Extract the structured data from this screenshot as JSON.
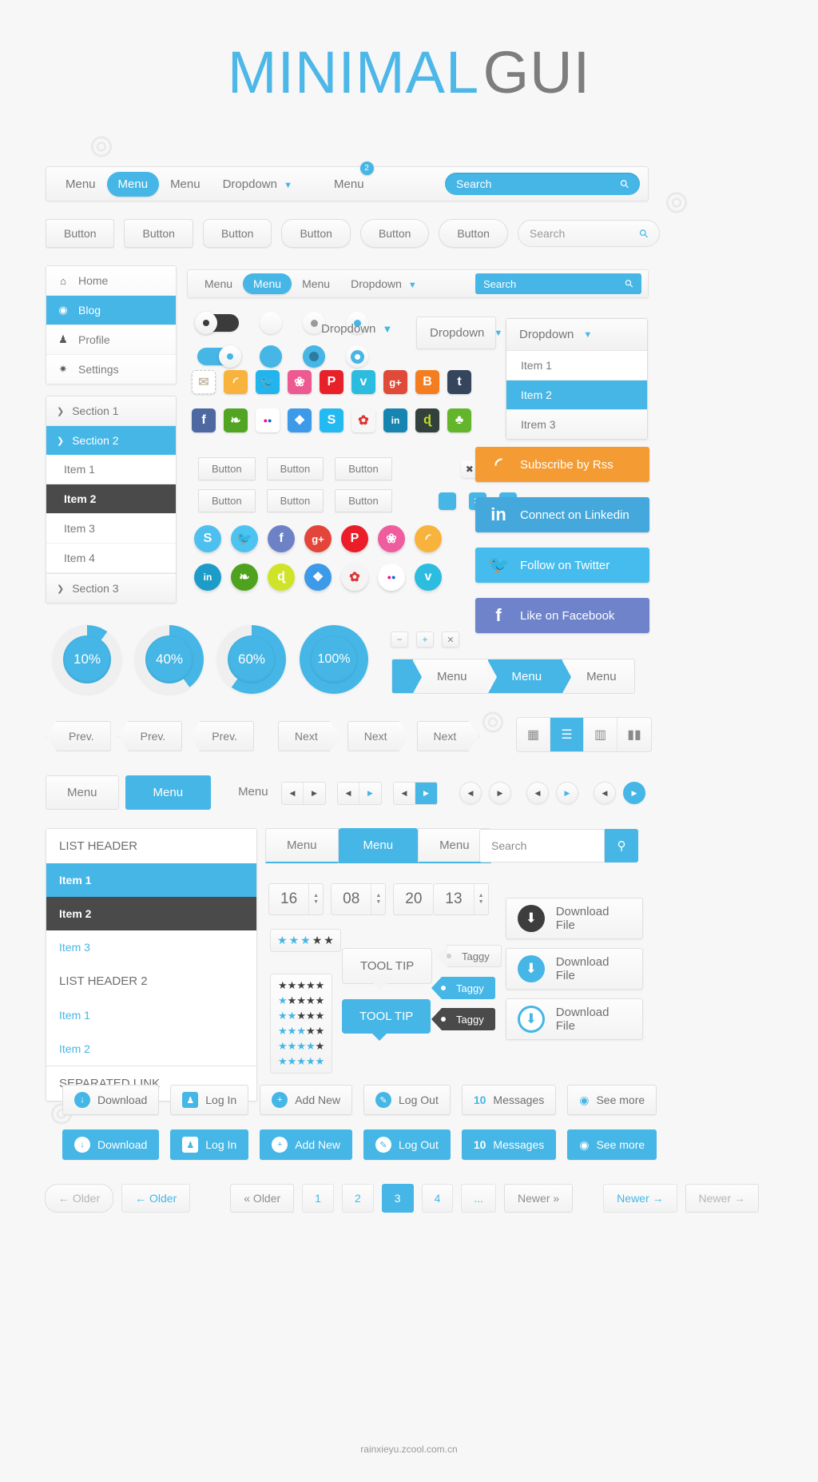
{
  "title": {
    "part1": "MINIMAL",
    "part2": "GUI"
  },
  "navbar1": {
    "items": [
      {
        "label": "Menu",
        "state": "normal"
      },
      {
        "label": "Menu",
        "state": "active"
      },
      {
        "label": "Menu",
        "state": "normal"
      },
      {
        "label": "Dropdown",
        "state": "dropdown"
      },
      {
        "label": "Menu",
        "state": "badge",
        "badge": "2"
      }
    ],
    "search_placeholder": "Search",
    "search_icon": "search-icon"
  },
  "buttonrow": {
    "buttons": [
      "Button",
      "Button",
      "Button",
      "Button",
      "Button",
      "Button"
    ],
    "search_placeholder": "Search"
  },
  "sidebar": {
    "items": [
      {
        "label": "Home",
        "icon": "home-icon",
        "active": false
      },
      {
        "label": "Blog",
        "icon": "record-icon",
        "active": true
      },
      {
        "label": "Profile",
        "icon": "user-icon",
        "active": false
      },
      {
        "label": "Settings",
        "icon": "gear-icon",
        "active": false
      }
    ]
  },
  "accordion": {
    "sections": [
      {
        "label": "Section 1",
        "open": false
      },
      {
        "label": "Section 2",
        "open": true
      },
      {
        "label": "Section 3",
        "open": false
      }
    ],
    "items": [
      {
        "label": "Item 1",
        "state": "normal"
      },
      {
        "label": "Item 2",
        "state": "dark"
      },
      {
        "label": "Item 3",
        "state": "normal"
      },
      {
        "label": "Item 4",
        "state": "normal"
      }
    ]
  },
  "navbar2": {
    "items": [
      {
        "label": "Menu",
        "state": "normal"
      },
      {
        "label": "Menu",
        "state": "active"
      },
      {
        "label": "Menu",
        "state": "normal"
      },
      {
        "label": "Dropdown",
        "state": "dropdown"
      }
    ],
    "search_placeholder": "Search"
  },
  "dropdowns": {
    "plain": "Dropdown",
    "boxed": "Dropdown",
    "open_header": "Dropdown",
    "open_items": [
      "Item 1",
      "Item 2",
      "Itrem 3"
    ],
    "selected_index": 1
  },
  "social_squares_row1": [
    {
      "name": "mail-icon",
      "glyph": "✉",
      "bg": "#ffffff",
      "fg": "#c9bba8"
    },
    {
      "name": "rss-icon",
      "glyph": "◜",
      "bg": "#f8b33c",
      "fg": "#ffffff"
    },
    {
      "name": "twitter-icon",
      "glyph": "t",
      "bg": "#22b4ed",
      "fg": "#ffffff"
    },
    {
      "name": "dribbble-icon",
      "glyph": "❀",
      "bg": "#ed5a92",
      "fg": "#ffffff"
    },
    {
      "name": "pinterest-icon",
      "glyph": "P",
      "bg": "#e8202a",
      "fg": "#ffffff"
    },
    {
      "name": "vimeo-icon",
      "glyph": "v",
      "bg": "#2bbce0",
      "fg": "#ffffff"
    },
    {
      "name": "googleplus-icon",
      "glyph": "g+",
      "bg": "#e04a39",
      "fg": "#ffffff"
    },
    {
      "name": "blogger-icon",
      "glyph": "B",
      "bg": "#f57d21",
      "fg": "#ffffff"
    },
    {
      "name": "tumblr-icon",
      "glyph": "t",
      "bg": "#35465c",
      "fg": "#ffffff"
    }
  ],
  "social_squares_row2": [
    {
      "name": "facebook-icon",
      "glyph": "f",
      "bg": "#4e69a2",
      "fg": "#ffffff"
    },
    {
      "name": "evernote-icon",
      "glyph": "❧",
      "bg": "#52a522",
      "fg": "#ffffff"
    },
    {
      "name": "flickr-icon",
      "glyph": "●●",
      "bg": "#ffffff",
      "fg": "#ff0084"
    },
    {
      "name": "dropbox-icon",
      "glyph": "❖",
      "bg": "#3d9ae8",
      "fg": "#ffffff"
    },
    {
      "name": "skype-icon",
      "glyph": "S",
      "bg": "#23baf2",
      "fg": "#ffffff"
    },
    {
      "name": "picasa-icon",
      "glyph": "✿",
      "bg": "#f6f6f6",
      "fg": "#6c3",
      "fg2": "#d33"
    },
    {
      "name": "linkedin-icon",
      "glyph": "in",
      "bg": "#1686b0",
      "fg": "#ffffff"
    },
    {
      "name": "deviantart-icon",
      "glyph": "ɖ",
      "bg": "#33413d",
      "fg": "#c5e021"
    },
    {
      "name": "forrst-icon",
      "glyph": "♣",
      "bg": "#63b62b",
      "fg": "#ffffff"
    }
  ],
  "social_round_row1": [
    {
      "name": "skype-icon",
      "glyph": "S",
      "bg": "#4ec0f0"
    },
    {
      "name": "twitter-icon",
      "glyph": "t",
      "bg": "#4cc3f0"
    },
    {
      "name": "facebook-icon",
      "glyph": "f",
      "bg": "#6d82c6"
    },
    {
      "name": "googleplus-icon",
      "glyph": "g+",
      "bg": "#e4453a"
    },
    {
      "name": "pinterest-icon",
      "glyph": "P",
      "bg": "#ea1d28"
    },
    {
      "name": "dribbble-icon",
      "glyph": "❀",
      "bg": "#ef5d9e"
    },
    {
      "name": "rss-icon",
      "glyph": "◜",
      "bg": "#f8b33c"
    }
  ],
  "social_round_row2": [
    {
      "name": "linkedin-icon",
      "glyph": "in",
      "bg": "#1e9cc9"
    },
    {
      "name": "evernote-icon",
      "glyph": "❧",
      "bg": "#4fa21e"
    },
    {
      "name": "deviantart-icon",
      "glyph": "ɖ",
      "bg": "#cfe428"
    },
    {
      "name": "dropbox-icon",
      "glyph": "❖",
      "bg": "#3d9ae8"
    },
    {
      "name": "picasa-icon",
      "glyph": "✿",
      "bg": "#f4f4f4"
    },
    {
      "name": "flickr-icon",
      "glyph": "●●",
      "bg": "#ffffff"
    },
    {
      "name": "vimeo-icon",
      "glyph": "v",
      "bg": "#2bbce0"
    }
  ],
  "big_social": [
    {
      "label": "Subscribe by Rss",
      "icon": "rss-icon",
      "glyph": "◜",
      "bg": "#f59b33"
    },
    {
      "label": "Connect on Linkedin",
      "icon": "linkedin-icon",
      "glyph": "in",
      "bg": "#45a8dd"
    },
    {
      "label": "Follow on Twitter",
      "icon": "twitter-icon",
      "glyph": "t",
      "bg": "#45bced"
    },
    {
      "label": "Like on Facebook",
      "icon": "facebook-icon",
      "glyph": "f",
      "bg": "#6e83c9"
    }
  ],
  "small_buttons": {
    "row1": [
      "Button",
      "Button",
      "Button"
    ],
    "row2": [
      "Button",
      "Button",
      "Button"
    ]
  },
  "checkboxes": {
    "row1": [
      {
        "name": "close-icon",
        "glyph": "✖",
        "style": "light-dark"
      },
      {
        "name": "check-icon",
        "glyph": "✔",
        "style": "light-blue"
      }
    ],
    "row2": [
      {
        "name": "square-icon",
        "glyph": "",
        "style": "solid"
      },
      {
        "name": "close-icon",
        "glyph": "✖",
        "style": "solid"
      },
      {
        "name": "check-icon",
        "glyph": "✔",
        "style": "solid"
      }
    ]
  },
  "donuts": [
    {
      "label": "10%",
      "value": 10
    },
    {
      "label": "40%",
      "value": 40
    },
    {
      "label": "60%",
      "value": 60
    },
    {
      "label": "100%",
      "value": 100
    }
  ],
  "zoom_controls": [
    {
      "name": "minus-icon",
      "glyph": "−"
    },
    {
      "name": "plus-icon",
      "glyph": "+"
    },
    {
      "name": "close-icon",
      "glyph": "✕"
    }
  ],
  "breadcrumbs": [
    {
      "label": "",
      "state": "blue"
    },
    {
      "label": "Menu",
      "state": "light"
    },
    {
      "label": "Menu",
      "state": "blue"
    },
    {
      "label": "Menu",
      "state": "light"
    }
  ],
  "prevnext": {
    "prev": [
      "Prev.",
      "Prev.",
      "Prev."
    ],
    "next": [
      "Next",
      "Next",
      "Next"
    ]
  },
  "viewswitch": [
    {
      "name": "grid-view-icon",
      "glyph": "▦",
      "on": false
    },
    {
      "name": "list-view-icon",
      "glyph": "☰",
      "on": true
    },
    {
      "name": "column-view-icon",
      "glyph": "⫼",
      "on": false
    },
    {
      "name": "gallery-view-icon",
      "glyph": "‖▮",
      "on": false
    }
  ],
  "tabs_row": [
    {
      "label": "Menu",
      "on": false
    },
    {
      "label": "Menu",
      "on": true
    },
    {
      "label": "Menu",
      "on": false
    }
  ],
  "pagers": {
    "squares": [
      {
        "left": "◀",
        "right": "▶",
        "style": "plain"
      },
      {
        "left": "◀",
        "right": "▶",
        "style": "blue-arrow"
      },
      {
        "left": "◀",
        "right": "▶",
        "style": "blue-bg"
      }
    ],
    "circles": [
      {
        "left": "◀",
        "right": "▶",
        "style": "plain"
      },
      {
        "left": "◀",
        "right": "▶",
        "style": "blue-arrow"
      },
      {
        "left": "◀",
        "right": "▶",
        "style": "blue-bg"
      }
    ]
  },
  "list_panel": [
    {
      "label": "LIST HEADER",
      "type": "header"
    },
    {
      "label": "Item 1",
      "type": "blue"
    },
    {
      "label": "Item 2",
      "type": "dark"
    },
    {
      "label": "Item 3",
      "type": "link"
    },
    {
      "label": "LIST HEADER 2",
      "type": "header"
    },
    {
      "label": "Item 1",
      "type": "link"
    },
    {
      "label": "Item 2",
      "type": "link"
    },
    {
      "label": "SEPARATED LINK",
      "type": "sep"
    }
  ],
  "tabs_panel": [
    {
      "label": "Menu",
      "on": false
    },
    {
      "label": "Menu",
      "on": true
    },
    {
      "label": "Menu",
      "on": false
    }
  ],
  "search_panel": {
    "placeholder": "Search",
    "icon": "search-icon"
  },
  "spinners": [
    {
      "value": "16"
    },
    {
      "value": "08"
    },
    {
      "value": "20"
    },
    {
      "value": "13"
    }
  ],
  "stars": [
    {
      "filled": 3,
      "total": 5
    },
    {
      "filled": 0,
      "total": 5
    },
    {
      "filled": 1,
      "total": 5
    },
    {
      "filled": 2,
      "total": 5
    },
    {
      "filled": 3,
      "total": 5
    },
    {
      "filled": 4,
      "total": 5
    },
    {
      "filled": 5,
      "total": 5
    }
  ],
  "tooltips": [
    {
      "label": "TOOL TIP",
      "style": "light"
    },
    {
      "label": "TOOL TIP",
      "style": "blue"
    }
  ],
  "taggy": [
    {
      "label": "Taggy",
      "style": "light"
    },
    {
      "label": "Taggy",
      "style": "blue"
    },
    {
      "label": "Taggy",
      "style": "dark"
    }
  ],
  "downloads": [
    {
      "label": "Download File",
      "style": "dark",
      "icon": "download-icon"
    },
    {
      "label": "Download File",
      "style": "blue",
      "icon": "download-icon"
    },
    {
      "label": "Download File",
      "style": "outline",
      "icon": "download-icon"
    }
  ],
  "actions_row1": [
    {
      "label": "Download",
      "icon": "download-icon",
      "glyph": "↓"
    },
    {
      "label": "Log In",
      "icon": "user-icon",
      "glyph": "♟"
    },
    {
      "label": "Add New",
      "icon": "plus-icon",
      "glyph": "+"
    },
    {
      "label": "Log Out",
      "icon": "pencil-icon",
      "glyph": "✎"
    },
    {
      "label": "Messages",
      "icon": "message-icon",
      "count": "10"
    },
    {
      "label": "See more",
      "icon": "eye-icon",
      "glyph": "◉"
    }
  ],
  "actions_row2": [
    {
      "label": "Download",
      "icon": "download-icon",
      "glyph": "↓"
    },
    {
      "label": "Log In",
      "icon": "user-icon",
      "glyph": "♟"
    },
    {
      "label": "Add New",
      "icon": "plus-icon",
      "glyph": "+"
    },
    {
      "label": "Log Out",
      "icon": "pencil-icon",
      "glyph": "✎"
    },
    {
      "label": "Messages",
      "icon": "message-icon",
      "count": "10"
    },
    {
      "label": "See more",
      "icon": "eye-icon",
      "glyph": "◉"
    }
  ],
  "pagination": {
    "older1": "←  Older",
    "older2": "←  Older",
    "older3": "« Older",
    "pages": [
      "1",
      "2",
      "3",
      "4",
      "..."
    ],
    "current": "3",
    "newer_text": "Newer »",
    "newer_link": "Newer →",
    "newer_dim": "Newer →"
  },
  "footer": "rainxieyu.zcool.com.cn",
  "colors": {
    "accent": "#45b6e6",
    "dark": "#4a4a4a",
    "bg": "#f7f7f7",
    "text": "#777777"
  }
}
